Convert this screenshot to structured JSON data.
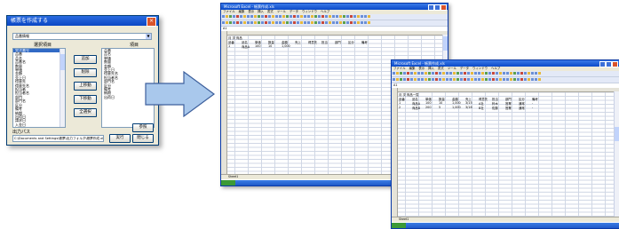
{
  "dialog": {
    "title": "帳票を作成する",
    "close_glyph": "×",
    "dropdown_value": "品番情報",
    "dropdown_arrow": "▼",
    "left_list_header": "選択項目",
    "right_list_header": "項目",
    "left_items": [
      "受注番号",
      "品番",
      "品名",
      "品番名",
      "数量",
      "単価",
      "金額",
      "売上日",
      "得意先",
      "得意先名",
      "担当者",
      "担当者名",
      "部門",
      "部門名",
      "区分",
      "備考",
      "納期",
      "出荷日",
      "請求日",
      "入金日"
    ],
    "right_items": [
      "品番",
      "品名",
      "単価",
      "数量",
      "金額",
      "売上日",
      "得意先名",
      "担当者名",
      "部門名",
      "区分",
      "備考",
      "納期",
      "出荷日"
    ],
    "buttons": {
      "add": "追加",
      "remove": "削除",
      "up": "上移動",
      "down": "下移動",
      "all": "全選択"
    },
    "output_label": "出力パス",
    "output_path": "C:\\Documents and Settings\\帳票\\出力フォルダ\\帳票作成.xls",
    "browse_label": "参照",
    "ok_label": "実行",
    "cancel_label": "閉じる"
  },
  "arrow": {
    "fill": "#a9c8ec",
    "stroke": "#3d5f9c"
  },
  "excel_back": {
    "title": "Microsoft Excel - 帳票作成.xls",
    "menu": [
      "ファイル",
      "編集",
      "表示",
      "挿入",
      "書式",
      "ツール",
      "データ",
      "ウィンドウ",
      "ヘルプ"
    ],
    "cell_ref": "A1",
    "row1": "月 次 商品",
    "row2": [
      "品番",
      "品名",
      "単価",
      "数量",
      "金額",
      "売上",
      "得意先",
      "担当",
      "部門",
      "区分",
      "備考"
    ],
    "row3": [
      "1",
      "商品A",
      "100",
      "10",
      "1,000"
    ],
    "sheet_tab": "Sheet1"
  },
  "excel_front": {
    "title": "Microsoft Excel - 帳票作成.xls",
    "menu": [
      "ファイル",
      "編集",
      "表示",
      "挿入",
      "書式",
      "ツール",
      "データ",
      "ウィンドウ",
      "ヘルプ"
    ],
    "cell_ref": "A1",
    "row1": "月 次 商品一覧",
    "row2": [
      "品番",
      "品名",
      "単価",
      "数量",
      "金額",
      "売上",
      "得意先",
      "担当",
      "部門",
      "区分",
      "備考"
    ],
    "row3": [
      "1",
      "商品A",
      "100",
      "10",
      "1,000",
      "3/15",
      "A社",
      "鈴木",
      "営業",
      "通常",
      "-"
    ],
    "row4": [
      "2",
      "商品B",
      "200",
      "5",
      "1,000",
      "3/16",
      "B社",
      "佐藤",
      "営業",
      "通常",
      "-"
    ],
    "sheet_tab": "Sheet1"
  }
}
